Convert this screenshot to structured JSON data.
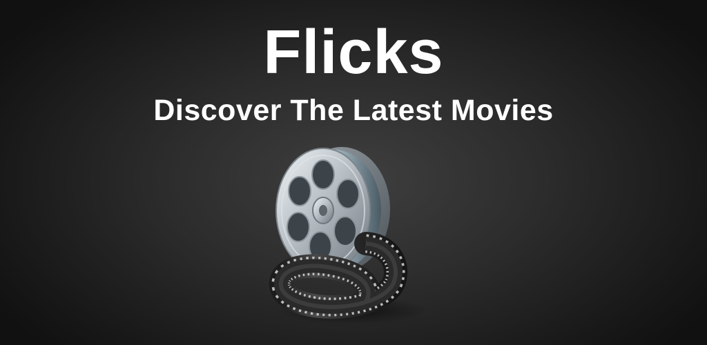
{
  "banner": {
    "title": "Flicks",
    "subtitle": "Discover The Latest Movies",
    "icon": "film-reel-icon"
  },
  "colors": {
    "background": "#2a2a2a",
    "text": "#ffffff",
    "reel_metal": "#b9c0c6",
    "film_strip": "#2b2b2b"
  }
}
